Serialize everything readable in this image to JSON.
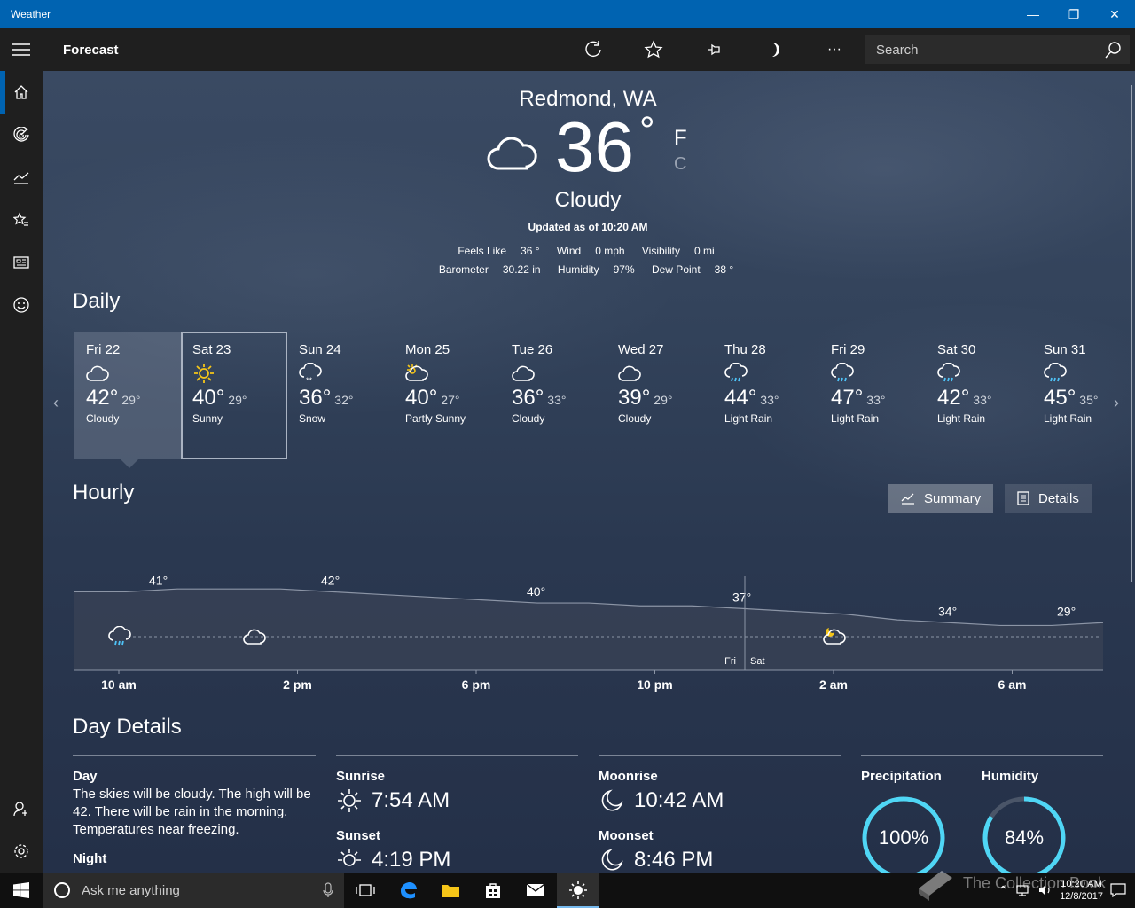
{
  "window": {
    "title": "Weather",
    "minimize": "—",
    "restore": "❐",
    "close": "✕"
  },
  "appbar": {
    "page_title": "Forecast",
    "search_placeholder": "Search",
    "more": "···"
  },
  "current": {
    "location": "Redmond, WA",
    "temp": "36",
    "degree": "°",
    "unit_f": "F",
    "unit_c": "C",
    "condition": "Cloudy",
    "updated": "Updated as of 10:20 AM",
    "metrics_row1": [
      {
        "label": "Feels Like",
        "value": "36 °"
      },
      {
        "label": "Wind",
        "value": "0 mph"
      },
      {
        "label": "Visibility",
        "value": "0 mi"
      }
    ],
    "metrics_row2": [
      {
        "label": "Barometer",
        "value": "30.22 in"
      },
      {
        "label": "Humidity",
        "value": "97%"
      },
      {
        "label": "Dew Point",
        "value": "38 °"
      }
    ]
  },
  "daily": {
    "heading": "Daily",
    "days": [
      {
        "name": "Fri 22",
        "hi": "42°",
        "lo": "29°",
        "cond": "Cloudy",
        "icon": "cloud-icon"
      },
      {
        "name": "Sat 23",
        "hi": "40°",
        "lo": "29°",
        "cond": "Sunny",
        "icon": "sun-icon"
      },
      {
        "name": "Sun 24",
        "hi": "36°",
        "lo": "32°",
        "cond": "Snow",
        "icon": "snow-icon"
      },
      {
        "name": "Mon 25",
        "hi": "40°",
        "lo": "27°",
        "cond": "Partly Sunny",
        "icon": "partly-sunny-icon"
      },
      {
        "name": "Tue 26",
        "hi": "36°",
        "lo": "33°",
        "cond": "Cloudy",
        "icon": "cloud-icon"
      },
      {
        "name": "Wed 27",
        "hi": "39°",
        "lo": "29°",
        "cond": "Cloudy",
        "icon": "cloud-icon"
      },
      {
        "name": "Thu 28",
        "hi": "44°",
        "lo": "33°",
        "cond": "Light Rain",
        "icon": "rain-icon"
      },
      {
        "name": "Fri 29",
        "hi": "47°",
        "lo": "33°",
        "cond": "Light Rain",
        "icon": "rain-icon"
      },
      {
        "name": "Sat 30",
        "hi": "42°",
        "lo": "33°",
        "cond": "Light Rain",
        "icon": "rain-icon"
      },
      {
        "name": "Sun 31",
        "hi": "45°",
        "lo": "35°",
        "cond": "Light Rain",
        "icon": "rain-icon"
      }
    ]
  },
  "hourly": {
    "heading": "Hourly",
    "summary_label": "Summary",
    "details_label": "Details",
    "temps": [
      41,
      41,
      42,
      42,
      42,
      41,
      40,
      39,
      38,
      37,
      37,
      36,
      36,
      35,
      34,
      33,
      31,
      30,
      29,
      29,
      30
    ],
    "labels": [
      {
        "index": 1,
        "text": "41°"
      },
      {
        "index": 5,
        "text": "42°"
      },
      {
        "index": 9,
        "text": "40°"
      },
      {
        "index": 13,
        "text": "37°"
      },
      {
        "index": 17,
        "text": "34°"
      },
      {
        "index": 21,
        "text": "29°"
      }
    ],
    "times": [
      "10 am",
      "2 pm",
      "6 pm",
      "10 pm",
      "2 am",
      "6 am"
    ],
    "day_split": {
      "left": "Fri",
      "right": "Sat"
    },
    "icons": [
      "rain-icon",
      "cloud-icon",
      "partly-cloudy-night-icon"
    ]
  },
  "day_details": {
    "heading": "Day Details",
    "day_label": "Day",
    "day_text": "The skies will be cloudy. The high will be 42. There will be rain in the morning. Temperatures near freezing.",
    "night_label": "Night",
    "sunrise_label": "Sunrise",
    "sunrise": "7:54 AM",
    "sunset_label": "Sunset",
    "sunset": "4:19 PM",
    "moonrise_label": "Moonrise",
    "moonrise": "10:42 AM",
    "moonset_label": "Moonset",
    "moonset": "8:46 PM",
    "precip_label": "Precipitation",
    "precip": "100%",
    "precip_fraction": 1.0,
    "humidity_label": "Humidity",
    "humidity": "84%",
    "humidity_fraction": 0.84
  },
  "taskbar": {
    "cortana_placeholder": "Ask me anything",
    "clock_time": "10:20 AM",
    "clock_date": "12/8/2017"
  },
  "watermark": "The Collection Book",
  "colors": {
    "accent": "#0063b1",
    "ring": "#4fd6f5",
    "sun": "#f5c518"
  }
}
